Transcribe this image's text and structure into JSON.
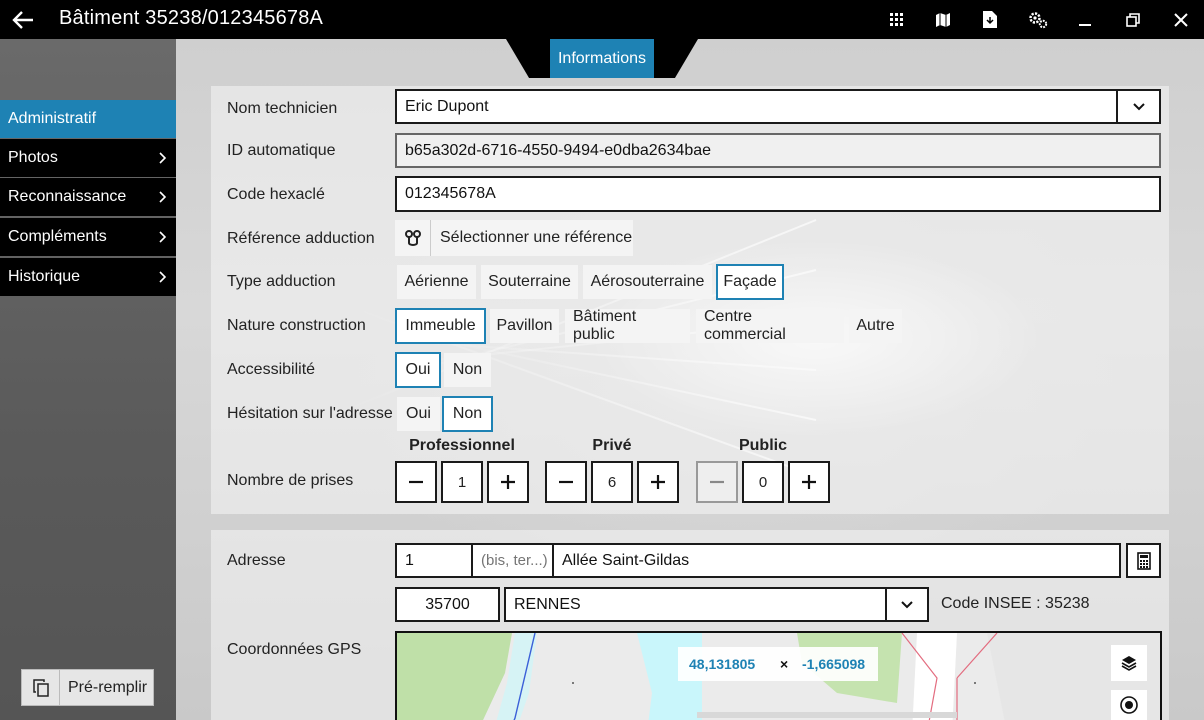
{
  "window": {
    "title": "Bâtiment 35238/012345678A"
  },
  "tab": {
    "label": "Informations"
  },
  "sidebar": {
    "items": [
      {
        "label": "Administratif"
      },
      {
        "label": "Photos"
      },
      {
        "label": "Reconnaissance"
      },
      {
        "label": "Compléments"
      },
      {
        "label": "Historique"
      }
    ],
    "prefill_label": "Pré-remplir"
  },
  "form": {
    "technician": {
      "label": "Nom technicien",
      "value": "Eric Dupont"
    },
    "auto_id": {
      "label": "ID automatique",
      "value": "b65a302d-6716-4550-9494-e0dba2634bae"
    },
    "hexacle": {
      "label": "Code hexaclé",
      "value": "012345678A"
    },
    "reference": {
      "label": "Référence adduction",
      "button": "Sélectionner une référence"
    },
    "adduction_type": {
      "label": "Type adduction",
      "options": [
        "Aérienne",
        "Souterraine",
        "Aérosouterraine",
        "Façade"
      ],
      "selected": "Façade"
    },
    "construction": {
      "label": "Nature construction",
      "options": [
        "Immeuble",
        "Pavillon",
        "Bâtiment public",
        "Centre commercial",
        "Autre"
      ],
      "selected": "Immeuble"
    },
    "accessibility": {
      "label": "Accessibilité",
      "options": [
        "Oui",
        "Non"
      ],
      "selected": "Oui"
    },
    "hesitation": {
      "label": "Hésitation sur l'adresse",
      "options": [
        "Oui",
        "Non"
      ],
      "selected": "Non"
    },
    "outlets": {
      "label": "Nombre de prises",
      "groups": [
        {
          "name": "Professionnel",
          "value": "1"
        },
        {
          "name": "Privé",
          "value": "6"
        },
        {
          "name": "Public",
          "value": "0"
        }
      ]
    }
  },
  "address": {
    "label": "Adresse",
    "number": "1",
    "suffix_placeholder": "(bis, ter...)",
    "street": "Allée Saint-Gildas",
    "postcode": "35700",
    "city": "RENNES",
    "insee": "Code INSEE :  35238"
  },
  "gps": {
    "label": "Coordonnées GPS",
    "lat": "48,131805",
    "sep": "×",
    "lon": "-1,665098"
  },
  "colors": {
    "accent": "#1e82b4",
    "titlebar": "#000000"
  }
}
